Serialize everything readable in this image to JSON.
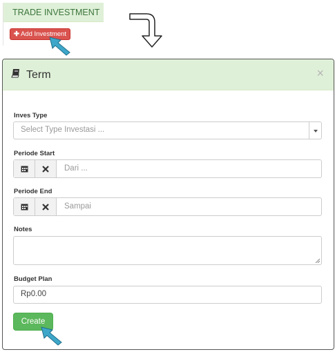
{
  "top": {
    "heading": "TRADE INVESTMENT",
    "add_button_label": "Add Investment"
  },
  "modal": {
    "title": "Term",
    "close_symbol": "×",
    "inves_type": {
      "label": "Inves Type",
      "placeholder": "Select Type Investasi ..."
    },
    "periode_start": {
      "label": "Periode Start",
      "placeholder": "Dari ..."
    },
    "periode_end": {
      "label": "Periode End",
      "placeholder": "Sampai"
    },
    "notes": {
      "label": "Notes",
      "value": ""
    },
    "budget_plan": {
      "label": "Budget Plan",
      "value": "Rp0.00"
    },
    "create_button_label": "Create"
  },
  "icons": {
    "plus": "plus-icon",
    "book": "book-icon",
    "calendar": "calendar-icon",
    "clear": "clear-icon",
    "pointer": "pointer-arrow-icon",
    "flow_arrow": "flow-arrow-icon"
  },
  "colors": {
    "header_bg": "#dff0d8",
    "danger": "#d9534f",
    "success": "#5cb85c",
    "pointer": "#3ea7c9"
  }
}
